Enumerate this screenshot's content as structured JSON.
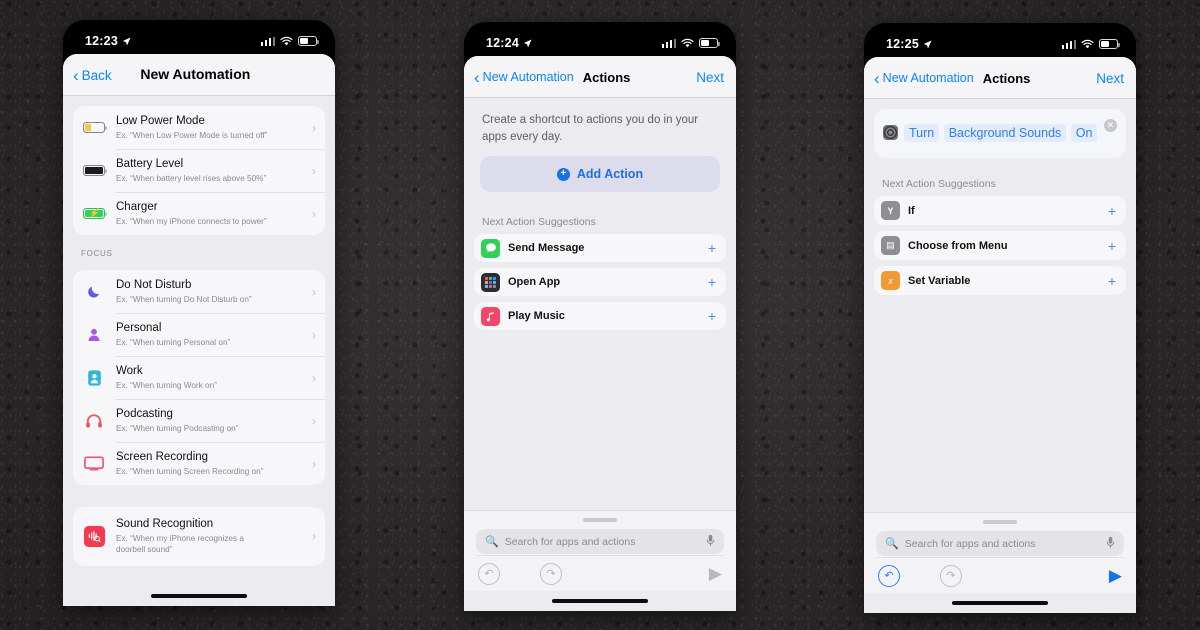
{
  "theme": {
    "accent": "#0a84ff",
    "screen_bg": "#ececf0",
    "card_bg": "#f7f7f9",
    "token_bg": "#e3ecfb"
  },
  "phones": [
    {
      "id": "phone-1",
      "status_bar": {
        "time": "12:23",
        "location_icon": "location-arrow-icon",
        "cellular_icon": "cellular-bars-icon",
        "wifi_icon": "wifi-icon",
        "battery_icon": "battery-icon"
      },
      "nav": {
        "back_label": "Back",
        "title": "New Automation",
        "back_icon": "chevron-left-icon"
      },
      "groups": [
        {
          "header": "",
          "rows": [
            {
              "icon": "battery-low-power-icon",
              "title": "Low Power Mode",
              "subtitle": "Ex. “When Low Power Mode is turned off”",
              "chevron": "chevron-right-icon"
            },
            {
              "icon": "battery-full-icon",
              "title": "Battery Level",
              "subtitle": "Ex. “When battery level rises above 50%”",
              "chevron": "chevron-right-icon"
            },
            {
              "icon": "battery-charging-icon",
              "title": "Charger",
              "subtitle": "Ex. “When my iPhone connects to power”",
              "chevron": "chevron-right-icon"
            }
          ]
        },
        {
          "header": "FOCUS",
          "rows": [
            {
              "icon": "moon-icon",
              "icon_color": "#5e5ce6",
              "glyph": "☾",
              "title": "Do Not Disturb",
              "subtitle": "Ex. “When turning Do Not Disturb on”",
              "chevron": "chevron-right-icon"
            },
            {
              "icon": "person-icon",
              "icon_color": "#a855e8",
              "glyph": "●",
              "title": "Personal",
              "subtitle": "Ex. “When turning Personal on”",
              "chevron": "chevron-right-icon"
            },
            {
              "icon": "id-badge-icon",
              "icon_color": "#32b5d4",
              "glyph": "",
              "title": "Work",
              "subtitle": "Ex. “When turning Work on”",
              "chevron": "chevron-right-icon"
            },
            {
              "icon": "headphones-icon",
              "icon_color": "#f05454",
              "glyph": "",
              "title": "Podcasting",
              "subtitle": "Ex. “When turning Podcasting on”",
              "chevron": "chevron-right-icon"
            },
            {
              "icon": "monitor-icon",
              "icon_color": "#ef4f77",
              "glyph": "",
              "title": "Screen Recording",
              "subtitle": "Ex. “When turning Screen Recording on”",
              "chevron": "chevron-right-icon"
            }
          ]
        },
        {
          "header": "",
          "rows": [
            {
              "icon": "sound-recognition-icon",
              "icon_color": "#f23b53",
              "title": "Sound Recognition",
              "subtitle": "Ex. “When my iPhone recognizes a doorbell sound”",
              "chevron": "chevron-right-icon"
            }
          ]
        }
      ]
    },
    {
      "id": "phone-2",
      "status_bar": {
        "time": "12:24",
        "location_icon": "location-arrow-icon",
        "cellular_icon": "cellular-bars-icon",
        "wifi_icon": "wifi-icon",
        "battery_icon": "battery-icon"
      },
      "nav": {
        "back_label": "New Automation",
        "title": "Actions",
        "next_label": "Next",
        "back_icon": "chevron-left-icon"
      },
      "intro": "Create a shortcut to actions you do in your apps every day.",
      "add_action": {
        "label": "Add Action",
        "icon": "plus-circle-icon"
      },
      "suggestions_header": "Next Action Suggestions",
      "suggestions": [
        {
          "icon": "messages-icon",
          "icon_color": "#30d158",
          "label": "Send Message",
          "add_icon": "plus-icon"
        },
        {
          "icon": "app-library-icon",
          "icon_color": "#2b2b38",
          "label": "Open App",
          "add_icon": "plus-icon"
        },
        {
          "icon": "music-icon",
          "icon_color": "#f2476a",
          "label": "Play Music",
          "add_icon": "plus-icon"
        }
      ],
      "bottom": {
        "search_placeholder": "Search for apps and actions",
        "search_icon": "search-icon",
        "mic_icon": "microphone-icon",
        "undo_icon": "undo-icon",
        "redo_icon": "redo-icon",
        "play_icon": "play-icon",
        "undo_active": false,
        "play_active": false
      }
    },
    {
      "id": "phone-3",
      "status_bar": {
        "time": "12:25",
        "location_icon": "location-arrow-icon",
        "cellular_icon": "cellular-bars-icon",
        "wifi_icon": "wifi-icon",
        "battery_icon": "battery-icon"
      },
      "nav": {
        "back_label": "New Automation",
        "title": "Actions",
        "next_label": "Next",
        "back_icon": "chevron-left-icon"
      },
      "action_card": {
        "icon": "background-sounds-icon",
        "close_icon": "close-icon",
        "tokens": [
          "Turn",
          "Background Sounds",
          "On"
        ]
      },
      "suggestions_header": "Next Action Suggestions",
      "suggestions": [
        {
          "icon": "if-icon",
          "icon_color": "#8e8e93",
          "glyph": "Y",
          "label": "If",
          "add_icon": "plus-icon"
        },
        {
          "icon": "choose-from-menu-icon",
          "icon_color": "#8e8e93",
          "glyph": "▤",
          "label": "Choose from Menu",
          "add_icon": "plus-icon"
        },
        {
          "icon": "set-variable-icon",
          "icon_color": "#f09a33",
          "glyph": "x",
          "label": "Set Variable",
          "add_icon": "plus-icon"
        }
      ],
      "bottom": {
        "search_placeholder": "Search for apps and actions",
        "search_icon": "search-icon",
        "mic_icon": "microphone-icon",
        "undo_icon": "undo-icon",
        "redo_icon": "redo-icon",
        "play_icon": "play-icon",
        "undo_active": true,
        "play_active": true
      }
    }
  ]
}
